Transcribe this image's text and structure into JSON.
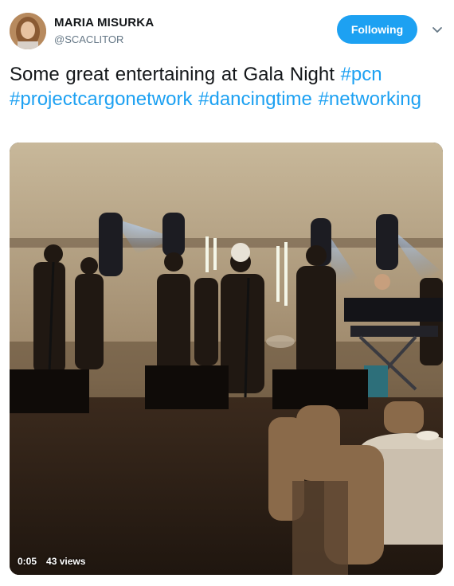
{
  "tweet": {
    "author": {
      "name": "MARIA MISURKA",
      "handle": "@SCACLITOR"
    },
    "follow_button_label": "Following",
    "menu_icon": "chevron-down-icon",
    "text_parts": [
      {
        "type": "text",
        "value": "Some great entertaining at Gala Night "
      },
      {
        "type": "hashtag",
        "value": "#pcn"
      },
      {
        "type": "text",
        "value": " "
      },
      {
        "type": "hashtag",
        "value": "#projectcargonetwork"
      },
      {
        "type": "text",
        "value": " "
      },
      {
        "type": "hashtag",
        "value": "#dancingtime"
      },
      {
        "type": "text",
        "value": " "
      },
      {
        "type": "hashtag",
        "value": "#networking"
      }
    ],
    "video": {
      "timestamp": "0:05",
      "views": "43 views"
    }
  },
  "colors": {
    "accent": "#1da1f2",
    "name_text": "#14171a",
    "secondary_text": "#657786"
  }
}
